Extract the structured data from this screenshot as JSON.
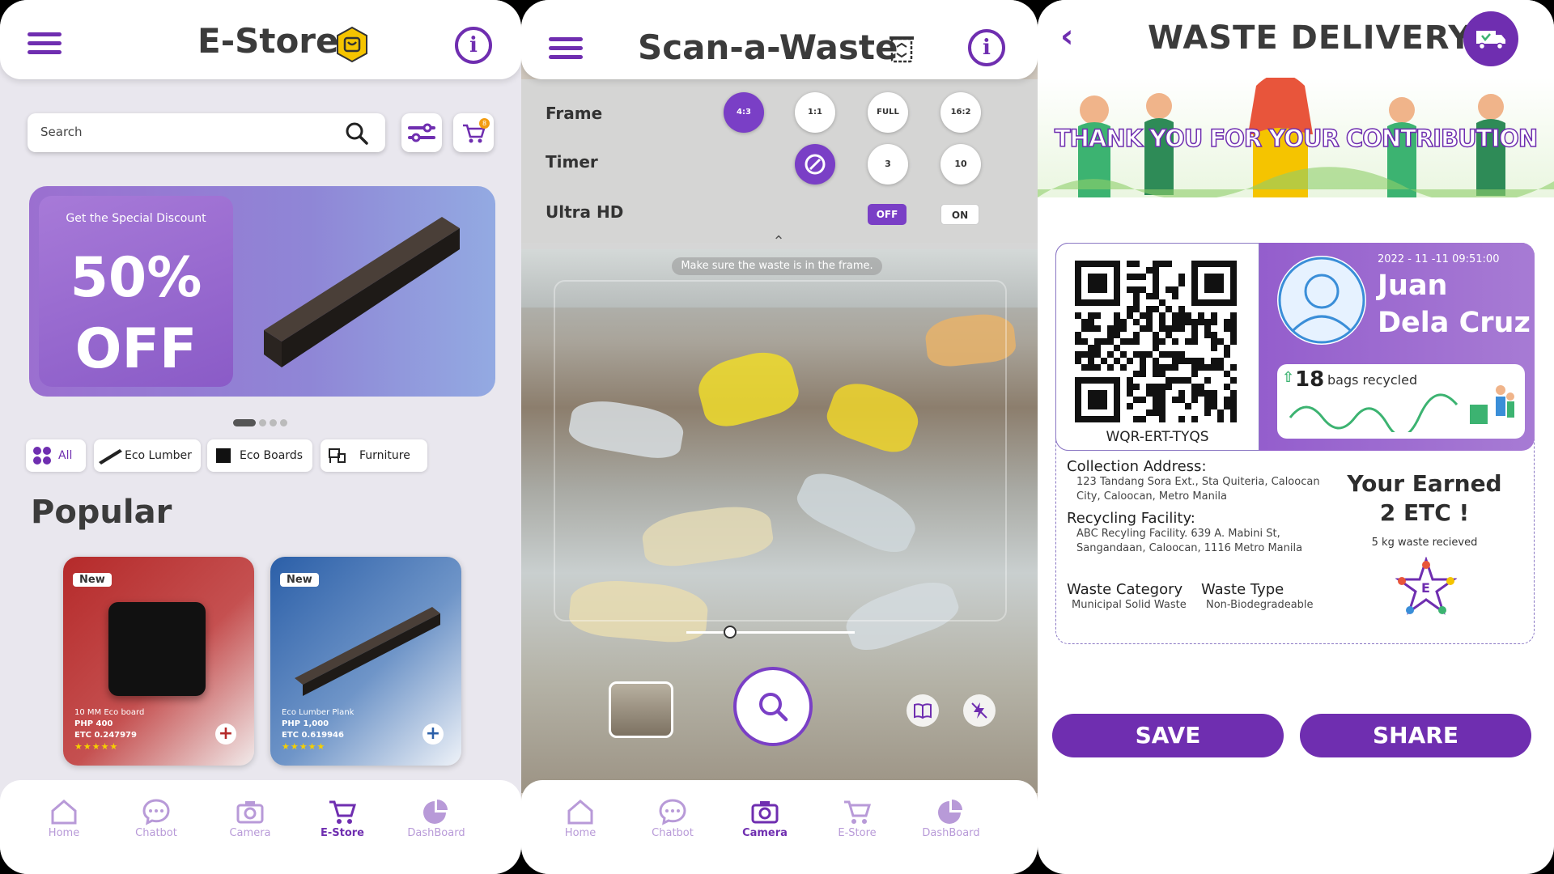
{
  "colors": {
    "accent": "#6f2eb0",
    "accent_light": "#b89ad8",
    "badge": "#f39c12"
  },
  "estore": {
    "title": "E-Store",
    "search_placeholder": "Search",
    "cart_count": "8",
    "banner": {
      "kicker": "Get the Special Discount",
      "line1": "50%",
      "line2": "OFF"
    },
    "categories": [
      "All",
      "Eco Lumber",
      "Eco Boards",
      "Furniture"
    ],
    "section_title": "Popular",
    "products": [
      {
        "tag": "New",
        "name": "10 MM Eco board",
        "price": "PHP 400",
        "etc": "ETC 0.247979",
        "stars": "★★★★★"
      },
      {
        "tag": "New",
        "name": "Eco Lumber Plank",
        "price": "PHP 1,000",
        "etc": "ETC 0.619946",
        "stars": "★★★★★"
      }
    ],
    "nav": [
      "Home",
      "Chatbot",
      "Camera",
      "E-Store",
      "DashBoard"
    ],
    "nav_active": "E-Store"
  },
  "scan": {
    "title": "Scan-a-Waste",
    "frame_label": "Frame",
    "timer_label": "Timer",
    "uhd_label": "Ultra HD",
    "frame_options": [
      "4:3",
      "1:1",
      "FULL",
      "16:2"
    ],
    "timer_options": [
      "",
      "3",
      "10"
    ],
    "uhd_off": "OFF",
    "uhd_on": "ON",
    "hint": "Make sure the waste is in the frame.",
    "nav": [
      "Home",
      "Chatbot",
      "Camera",
      "E-Store",
      "DashBoard"
    ],
    "nav_active": "Camera"
  },
  "delivery": {
    "title": "WASTE DELIVERY",
    "thank_you": "THANK YOU FOR YOUR CONTRIBUTION",
    "qr_code": "WQR-ERT-TYQS",
    "timestamp": "2022 - 11 -11  09:51:00",
    "first_name": "Juan",
    "last_name": "Dela Cruz",
    "bags_count": "18",
    "bags_label": "bags recycled",
    "collection_label": "Collection Address:",
    "collection_address": "123 Tandang Sora Ext., Sta Quiteria, Caloocan City, Caloocan, Metro Manila",
    "facility_label": "Recycling Facility:",
    "facility_address": "ABC Recyling Facility. 639 A. Mabini St, Sangandaan, Caloocan, 1116 Metro Manila",
    "category_label": "Waste Category",
    "category_value": "Municipal Solid Waste",
    "type_label": "Waste Type",
    "type_value": "Non-Biodegradeable",
    "earned_line1": "Your Earned",
    "earned_line2": "2 ETC !",
    "received": "5 kg waste recieved",
    "logo_letter": "E",
    "save": "SAVE",
    "share": "SHARE"
  }
}
